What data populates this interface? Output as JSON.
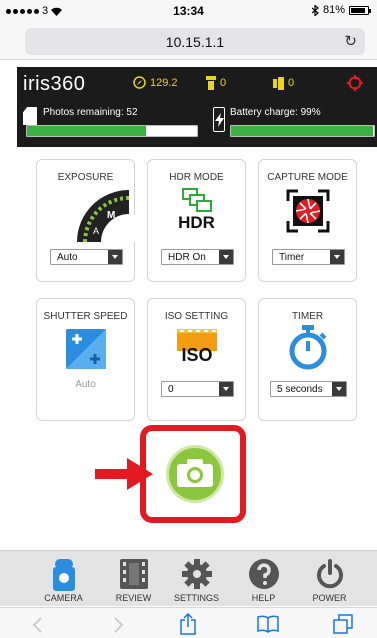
{
  "status_bar": {
    "carrier": "3",
    "time": "13:34",
    "battery_percent": "81%"
  },
  "browser": {
    "url": "10.15.1.1",
    "reload_icon": "reload-icon"
  },
  "app_header": {
    "logo": "iris360",
    "compass_value": "129.2",
    "light_count": "0",
    "sync_count": "0",
    "photos_label": "Photos remaining: 52",
    "photos_fraction": 0.7,
    "battery_label": "Battery charge: 99%",
    "battery_fraction": 0.99
  },
  "tiles": [
    {
      "title": "EXPOSURE",
      "value": "Auto",
      "icon": "exposure-dial-icon"
    },
    {
      "title": "HDR MODE",
      "value": "HDR On",
      "icon": "hdr-icon",
      "icon_text": "HDR"
    },
    {
      "title": "CAPTURE MODE",
      "value": "Timer",
      "icon": "aperture-icon"
    },
    {
      "title": "SHUTTER SPEED",
      "value": "Auto",
      "icon": "shutter-speed-icon"
    },
    {
      "title": "ISO SETTING",
      "value": "0",
      "icon": "iso-film-icon",
      "icon_text": "ISO"
    },
    {
      "title": "TIMER",
      "value": "5 seconds",
      "icon": "stopwatch-icon"
    }
  ],
  "shutter": {
    "icon": "camera-icon"
  },
  "nav": [
    {
      "label": "CAMERA",
      "icon": "camera-nav-icon"
    },
    {
      "label": "REVIEW",
      "icon": "film-icon"
    },
    {
      "label": "SETTINGS",
      "icon": "gear-icon"
    },
    {
      "label": "HELP",
      "icon": "help-icon"
    },
    {
      "label": "POWER",
      "icon": "power-icon"
    }
  ],
  "colors": {
    "accent_green": "#8cc63f",
    "accent_blue": "#2a8de0",
    "alert_red": "#e21b23",
    "header_yellow": "#e9d51c"
  }
}
